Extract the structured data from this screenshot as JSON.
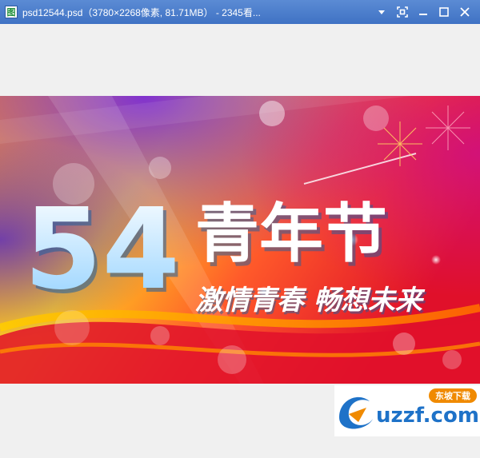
{
  "window": {
    "title": "psd12544.psd（3780×2268像素, 81.71MB） - 2345看...",
    "app_icon_glyph": "图",
    "controls": [
      "dropdown-icon",
      "fit-screen-icon",
      "minimize-icon",
      "maximize-icon",
      "close-icon"
    ]
  },
  "banner": {
    "number": "54",
    "headline": "青年节",
    "slogan": "激情青春 畅想未来"
  },
  "watermark": {
    "brand": "uzzf.com",
    "badge": "东坡下载"
  },
  "colors": {
    "titlebar": "#4a7fcb",
    "accent_red": "#e8192c",
    "accent_yellow": "#ffd400",
    "text_blue": "#9fd8ff",
    "watermark_blue": "#1e72c8",
    "watermark_orange": "#f08a00"
  }
}
